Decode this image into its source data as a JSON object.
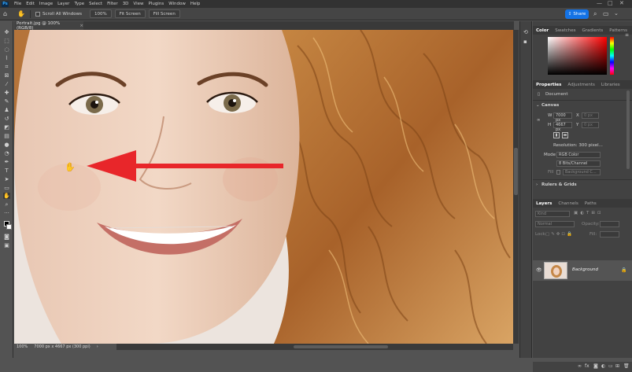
{
  "app": {
    "menus": [
      "File",
      "Edit",
      "Image",
      "Layer",
      "Type",
      "Select",
      "Filter",
      "3D",
      "View",
      "Plugins",
      "Window",
      "Help"
    ],
    "logo_text": "Ps",
    "window_controls": [
      "—",
      "□",
      "✕"
    ]
  },
  "options_bar": {
    "scroll_all_windows": "Scroll All Windows",
    "zoom_100": "100%",
    "fit_screen": "Fit Screen",
    "fill_screen": "Fill Screen",
    "share": "Share"
  },
  "document": {
    "tab_title": "Portrait.jpg @ 100% (RGB/8)",
    "tab_close": "×"
  },
  "status_bar": {
    "zoom": "100%",
    "doc_info": "7000 px x 4667 px (300 ppi)",
    "arrow": "›"
  },
  "color_panel": {
    "tabs": [
      "Color",
      "Swatches",
      "Gradients",
      "Patterns"
    ],
    "active_tab": "Color",
    "hue_color": "#ff0000"
  },
  "properties_panel": {
    "tabs": [
      "Properties",
      "Adjustments",
      "Libraries"
    ],
    "active_tab": "Properties",
    "document_label": "Document",
    "canvas_section": "Canvas",
    "w_label": "W",
    "w_value": "7000 px",
    "h_label": "H",
    "h_value": "4667 px",
    "x_label": "X",
    "x_value": "0 px",
    "y_label": "Y",
    "y_value": "0 px",
    "resolution": "Resolution: 300 pixel...",
    "mode_label": "Mode",
    "mode_value": "RGB Color",
    "bit_depth": "8 Bits/Channel",
    "fill_label": "Fill",
    "fill_value": "Background C...",
    "rulers_section": "Rulers & Grids"
  },
  "layers_panel": {
    "tabs": [
      "Layers",
      "Channels",
      "Paths"
    ],
    "active_tab": "Layers",
    "filter_kind": "Kind",
    "blend_mode": "Normal",
    "opacity_label": "Opacity:",
    "lock_label": "Lock:",
    "fill_label": "Fill:",
    "layer_name": "Background"
  },
  "colors": {
    "accent": "#1473e6",
    "arrow": "#e8262a",
    "hair": "#b8732f"
  }
}
